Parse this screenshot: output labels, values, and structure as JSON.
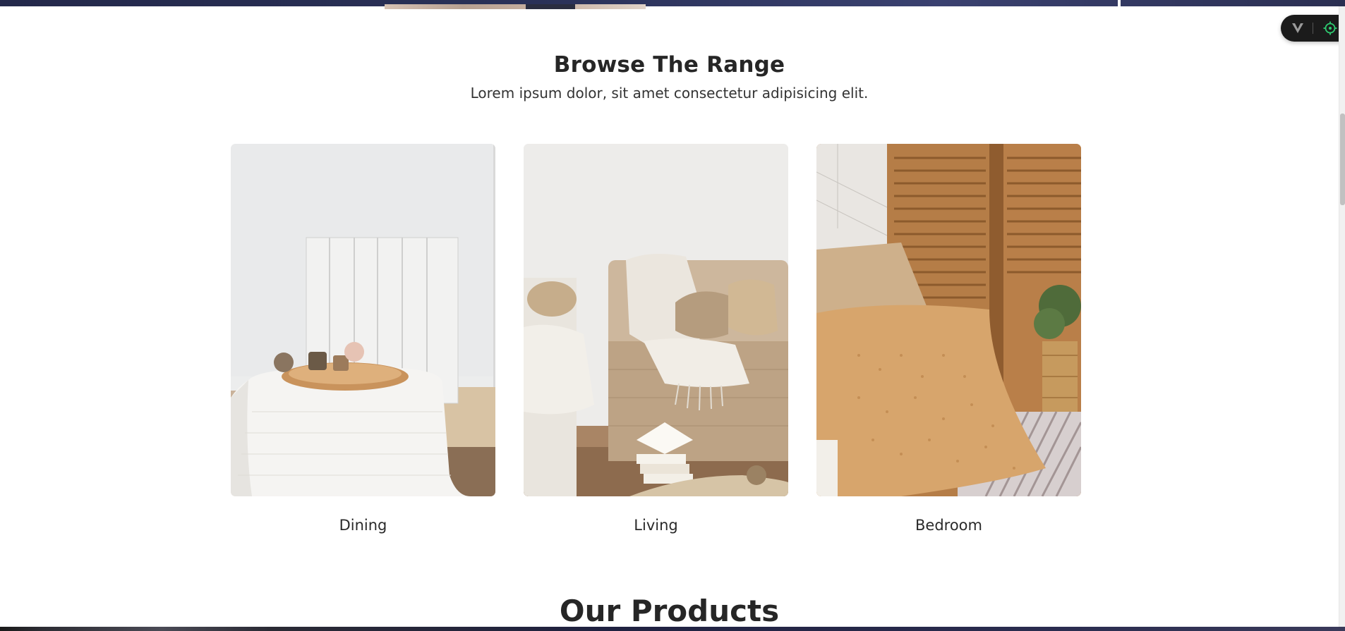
{
  "browse": {
    "title": "Browse The Range",
    "subtitle": "Lorem ipsum dolor, sit amet consectetur adipisicing elit."
  },
  "categories": [
    {
      "label": "Dining",
      "image": "dining-table-image"
    },
    {
      "label": "Living",
      "image": "living-room-sofa-image"
    },
    {
      "label": "Bedroom",
      "image": "bedroom-pillows-image"
    }
  ],
  "products": {
    "title": "Our Products"
  },
  "toolbar": {
    "icons": [
      "vue-devtools-icon",
      "target-icon"
    ]
  },
  "colors": {
    "heading": "#262626",
    "accent_green": "#2ecc71",
    "toolbar_bg": "#1b1b1b"
  }
}
